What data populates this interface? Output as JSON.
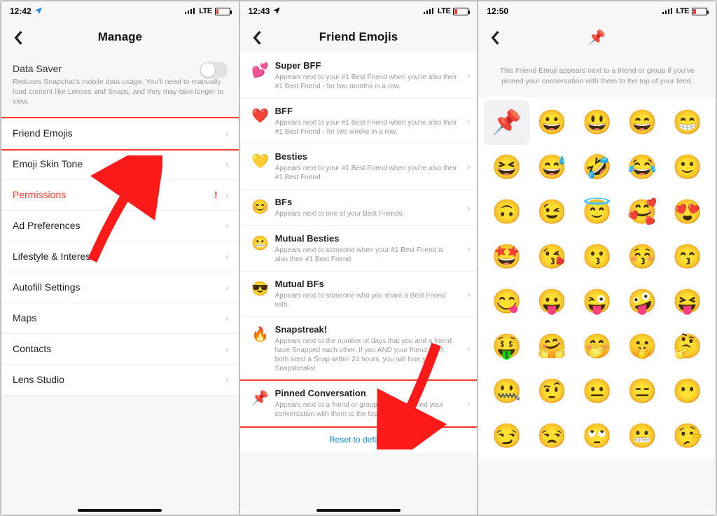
{
  "screen1": {
    "time": "12:42",
    "signal": "LTE",
    "title": "Manage",
    "datasaver_title": "Data Saver",
    "datasaver_desc": "Reduces Snapchat's mobile data usage. You'll need to manually load content like Lenses and Snaps, and they may take longer to view.",
    "items": [
      {
        "label": "Friend Emojis"
      },
      {
        "label": "Emoji Skin Tone"
      },
      {
        "label": "Permissions",
        "danger": true,
        "warn": "!"
      },
      {
        "label": "Ad Preferences"
      },
      {
        "label": "Lifestyle & Interests"
      },
      {
        "label": "Autofill Settings"
      },
      {
        "label": "Maps"
      },
      {
        "label": "Contacts"
      },
      {
        "label": "Lens Studio"
      }
    ]
  },
  "screen2": {
    "time": "12:43",
    "signal": "LTE",
    "title": "Friend Emojis",
    "items": [
      {
        "emoji": "💕",
        "title": "Super BFF",
        "desc": "Appears next to your #1 Best Friend when you're also their #1 Best Friend - for two months in a row."
      },
      {
        "emoji": "❤️",
        "title": "BFF",
        "desc": "Appears next to your #1 Best Friend when you're also their #1 Best Friend - for two weeks in a row."
      },
      {
        "emoji": "💛",
        "title": "Besties",
        "desc": "Appears next to your #1 Best Friend when you're also their #1 Best Friend."
      },
      {
        "emoji": "😊",
        "title": "BFs",
        "desc": "Appears next to one of your Best Friends."
      },
      {
        "emoji": "😬",
        "title": "Mutual Besties",
        "desc": "Appears next to someone when your #1 Best Friend is also their #1 Best Friend."
      },
      {
        "emoji": "😎",
        "title": "Mutual BFs",
        "desc": "Appears next to someone who you share a Best Friend with."
      },
      {
        "emoji": "🔥",
        "title": "Snapstreak!",
        "desc": "Appears next to the number of days that you and a friend have Snapped each other. If you AND your friend don't both send a Snap within 24 hours, you will lose your Snapstreaks!"
      },
      {
        "emoji": "📌",
        "title": "Pinned Conversation",
        "desc": "Appears next to a friend or group if you've pinned your conversation with them to the top of your feed."
      }
    ],
    "reset": "Reset to default"
  },
  "screen3": {
    "time": "12:50",
    "signal": "LTE",
    "header_emoji": "📌",
    "desc": "This Friend Emoji appears next to a friend or group if you've pinned your conversation with them to the top of your feed.",
    "emojis": [
      "📌",
      "😀",
      "😃",
      "😄",
      "😁",
      "😆",
      "😅",
      "🤣",
      "😂",
      "🙂",
      "🙃",
      "😉",
      "😇",
      "🥰",
      "😍",
      "🤩",
      "😘",
      "😗",
      "😚",
      "😙",
      "😋",
      "😛",
      "😜",
      "🤪",
      "😝",
      "🤑",
      "🤗",
      "🤭",
      "🤫",
      "🤔",
      "🤐",
      "🤨",
      "😐",
      "😑",
      "😶",
      "😏",
      "😒",
      "🙄",
      "😬",
      "🤥"
    ]
  }
}
